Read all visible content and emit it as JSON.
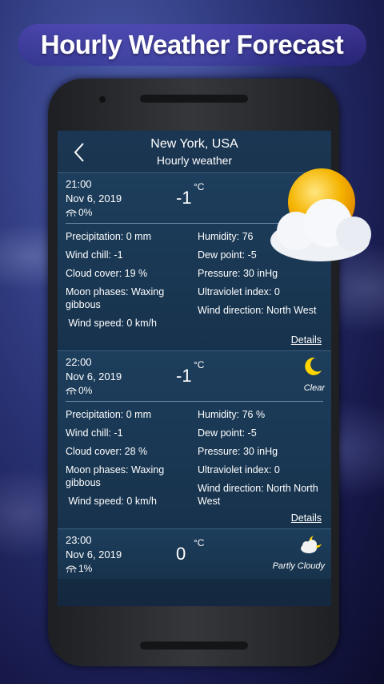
{
  "banner": {
    "title": "Hourly Weather Forecast"
  },
  "appbar": {
    "city": "New York, USA",
    "subtitle": "Hourly weather",
    "back_icon": "chevron-left-icon"
  },
  "hours": [
    {
      "time": "21:00",
      "date": "Nov 6, 2019",
      "rain": "0%",
      "temp": "-1",
      "unit": "°C",
      "condition": "",
      "icon": "sun-cloud-icon",
      "left": [
        "Precipitation: 0 mm",
        "Wind chill: -1",
        "Cloud cover: 19 %",
        "Moon phases: Waxing gibbous",
        " Wind speed: 0 km/h"
      ],
      "right": [
        "Humidity: 76",
        "Dew point: -5",
        "Pressure: 30 inHg",
        "Ultraviolet index: 0",
        "Wind direction: North West"
      ],
      "details": "Details"
    },
    {
      "time": "22:00",
      "date": "Nov 6, 2019",
      "rain": "0%",
      "temp": "-1",
      "unit": "°C",
      "condition": "Clear",
      "icon": "moon-icon",
      "left": [
        "Precipitation: 0 mm",
        "Wind chill: -1",
        "Cloud cover: 28 %",
        "Moon phases: Waxing gibbous",
        " Wind speed: 0 km/h"
      ],
      "right": [
        "Humidity: 76 %",
        "Dew point: -5",
        "Pressure: 30 inHg",
        "Ultraviolet index: 0",
        "Wind direction: North North West"
      ],
      "details": "Details"
    },
    {
      "time": "23:00",
      "date": "Nov 6, 2019",
      "rain": "1%",
      "temp": "0",
      "unit": "°C",
      "condition": "Partly Cloudy",
      "icon": "partly-cloudy-moon-icon"
    }
  ],
  "colors": {
    "accent_moon": "#ffd500",
    "sun": "#f5b400"
  }
}
